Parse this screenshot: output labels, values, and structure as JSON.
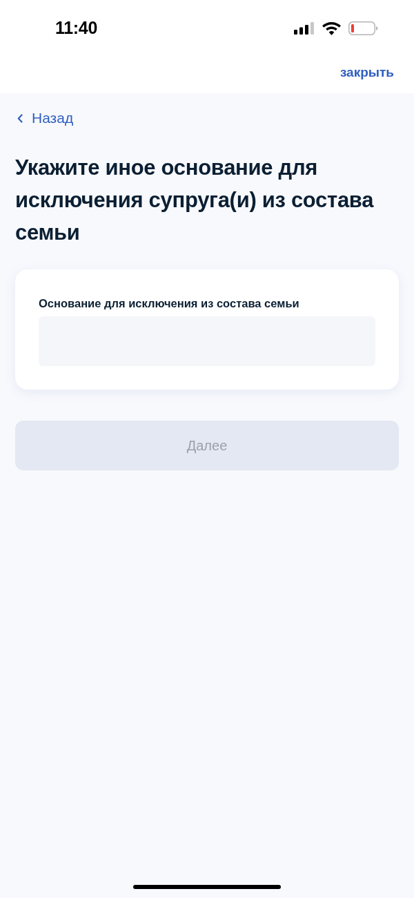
{
  "status_bar": {
    "time": "11:40"
  },
  "header": {
    "close_link": "закрыть"
  },
  "back_link": {
    "label": "Назад"
  },
  "title": "Укажите иное основание для исключения супруга(и) из состава семьи",
  "form_card": {
    "fields": [
      {
        "label": "Основание для исключения из состава семьи"
      }
    ]
  },
  "next_button": {
    "label": "Далее",
    "disabled": true
  }
}
